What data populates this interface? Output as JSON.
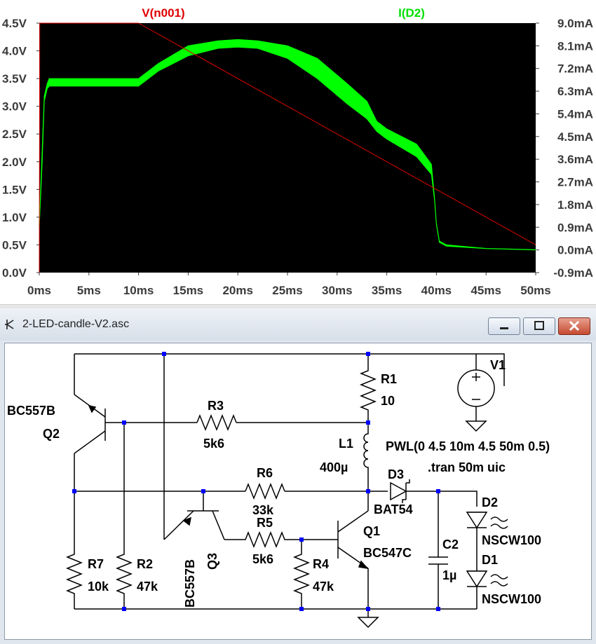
{
  "plot": {
    "trace_v_label": "V(n001)",
    "trace_i_label": "I(D2)",
    "trace_v_color": "#e00000",
    "trace_i_color": "#00ff00",
    "plot_background": "#000000",
    "left_axis_ticks": [
      "4.5V",
      "4.0V",
      "3.5V",
      "3.0V",
      "2.5V",
      "2.0V",
      "1.5V",
      "1.0V",
      "0.5V",
      "0.0V"
    ],
    "right_axis_ticks": [
      "9.0mA",
      "8.1mA",
      "7.2mA",
      "6.3mA",
      "5.4mA",
      "4.5mA",
      "3.6mA",
      "2.7mA",
      "1.8mA",
      "0.9mA",
      "0.0mA",
      "-0.9mA"
    ],
    "x_axis_ticks": [
      "0ms",
      "5ms",
      "10ms",
      "15ms",
      "20ms",
      "25ms",
      "30ms",
      "35ms",
      "40ms",
      "45ms",
      "50ms"
    ]
  },
  "chart_data": {
    "type": "line",
    "title": "",
    "xlabel": "",
    "ylabel": "",
    "xlim": [
      0,
      50
    ],
    "x_unit": "ms",
    "ylim_left": [
      0,
      4.5
    ],
    "ylim_right": [
      -0.9,
      9.0
    ],
    "grid": false,
    "series": [
      {
        "name": "V(n001)",
        "axis": "left",
        "color": "#e00000",
        "x": [
          0,
          0.05,
          10,
          50
        ],
        "y": [
          0,
          4.5,
          4.5,
          0.5
        ]
      },
      {
        "name": "I(D2)",
        "axis": "right",
        "color": "#00ff00",
        "x": [
          0,
          0.3,
          0.5,
          0.8,
          1,
          2,
          5,
          10,
          12,
          15,
          18,
          20,
          22,
          25,
          28,
          31,
          33,
          34,
          35,
          38,
          39.5,
          39.8,
          40,
          40.3,
          41,
          45,
          50
        ],
        "y_min": [
          0.9,
          3.5,
          5.9,
          6.4,
          6.5,
          6.5,
          6.5,
          6.5,
          7.1,
          7.7,
          8.0,
          8.05,
          8.0,
          7.6,
          6.8,
          5.8,
          5.2,
          4.7,
          4.4,
          3.7,
          3.0,
          2.0,
          1.0,
          0.3,
          0.15,
          0.05,
          0.0
        ],
        "y_max": [
          1.0,
          4.0,
          6.1,
          6.6,
          6.8,
          6.8,
          6.8,
          6.8,
          7.4,
          8.1,
          8.3,
          8.35,
          8.3,
          8.1,
          7.6,
          6.6,
          5.9,
          5.1,
          4.8,
          4.2,
          3.4,
          2.1,
          1.05,
          0.35,
          0.2,
          0.06,
          0.01
        ]
      }
    ]
  },
  "window": {
    "title": "2-LED-candle-V2.asc",
    "minimize_label": "minimize",
    "maximize_label": "maximize",
    "close_label": "close"
  },
  "schematic": {
    "q2_model": "BC557B",
    "q2_name": "Q2",
    "r3_name": "R3",
    "r3_value": "5k6",
    "r1_name": "R1",
    "r1_value": "10",
    "v1_name": "V1",
    "l1_name": "L1",
    "l1_value": "400µ",
    "v1_value": "PWL(0 4.5 10m 4.5 50m 0.5)",
    "tran_directive": ".tran 50m uic",
    "r6_name": "R6",
    "r6_value": "33k",
    "d3_name": "D3",
    "d3_model": "BAT54",
    "r5_name": "R5",
    "r5_value": "5k6",
    "q1_name": "Q1",
    "q1_model": "BC547C",
    "d2_name": "D2",
    "d2_model": "NSCW100",
    "d1_name": "D1",
    "d1_model": "NSCW100",
    "c2_name": "C2",
    "c2_value": "1µ",
    "r7_name": "R7",
    "r7_value": "10k",
    "r2_name": "R2",
    "r2_value": "47k",
    "q3_model": "BC557B",
    "q3_name": "Q3",
    "r4_name": "R4",
    "r4_value": "47k"
  }
}
